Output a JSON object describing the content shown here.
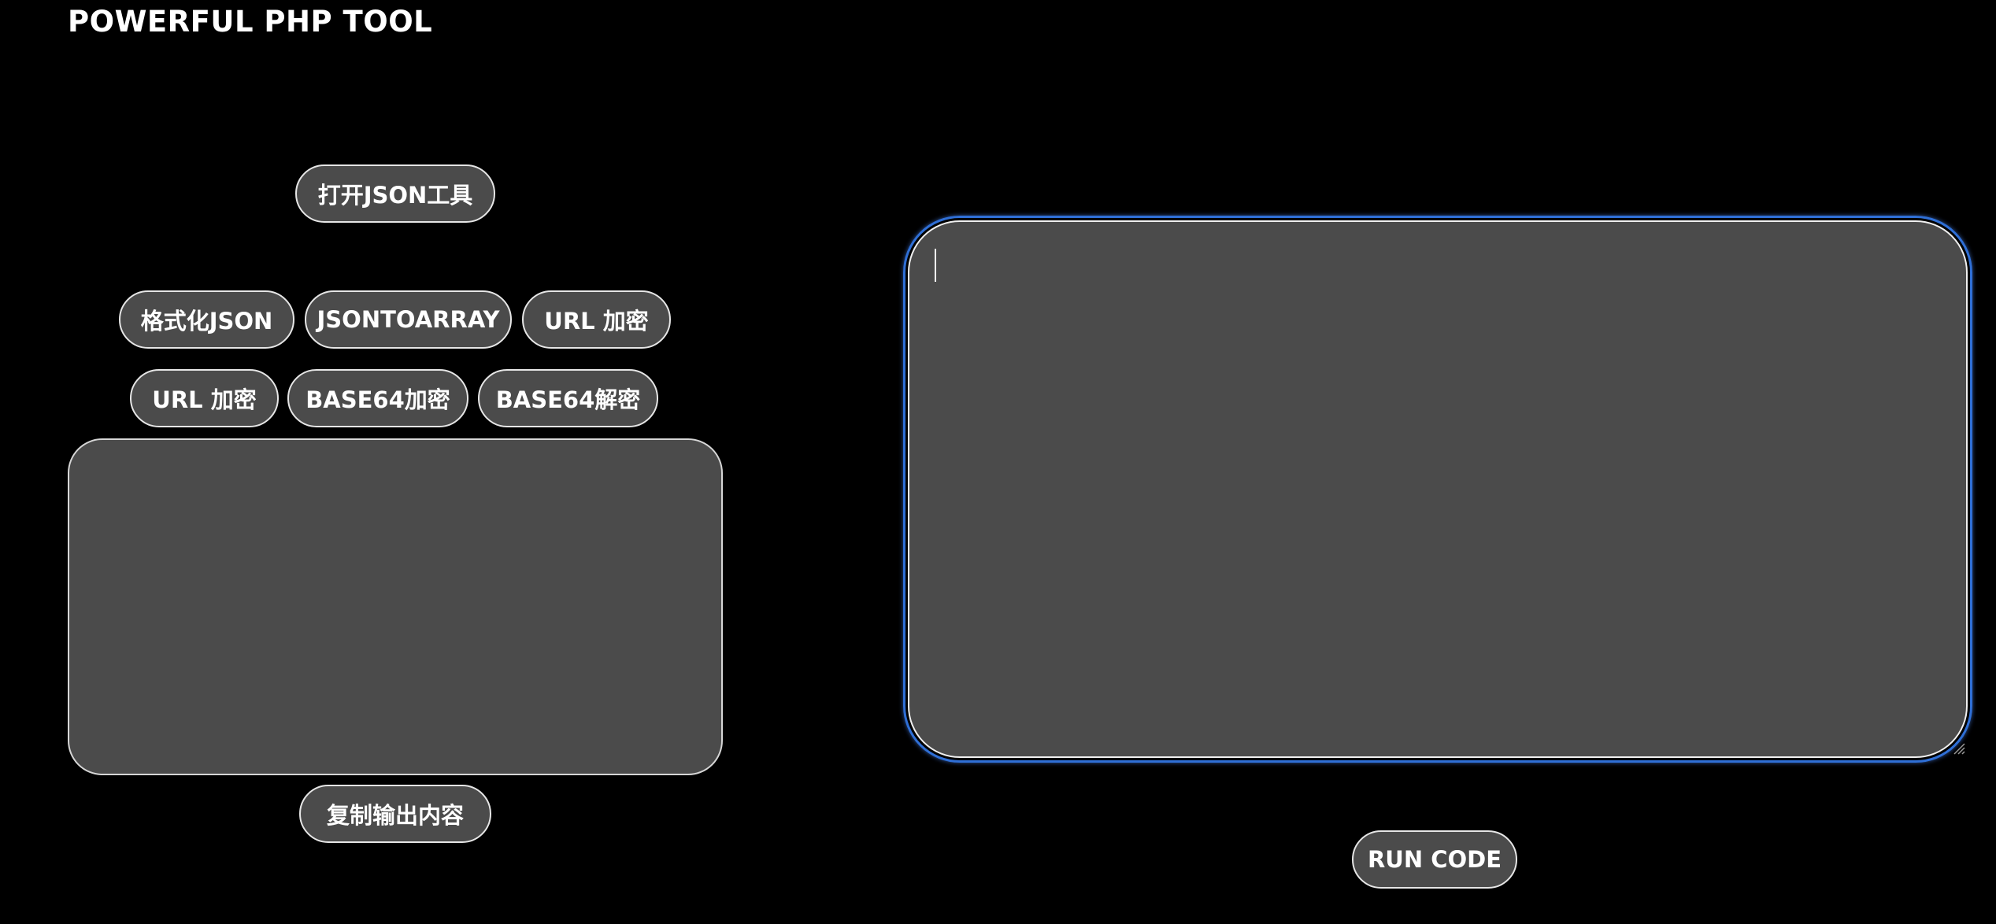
{
  "header": {
    "title": "POWERFUL PHP TOOL"
  },
  "toolbar": {
    "open_json_tool": "打开JSON工具",
    "format_json": "格式化JSON",
    "json_to_array": "JSONTOARRAY",
    "url_encode_1": "URL 加密",
    "url_encode_2": "URL 加密",
    "base64_encode": "BASE64加密",
    "base64_decode": "BASE64解密"
  },
  "output": {
    "value": "",
    "copy_label": "复制输出内容"
  },
  "editor": {
    "value": "",
    "run_label": "RUN CODE"
  },
  "colors": {
    "background": "#000000",
    "panel": "#4b4b4b",
    "border": "#e6e6e6",
    "focus_ring": "#2f6fd6",
    "text": "#ffffff"
  }
}
